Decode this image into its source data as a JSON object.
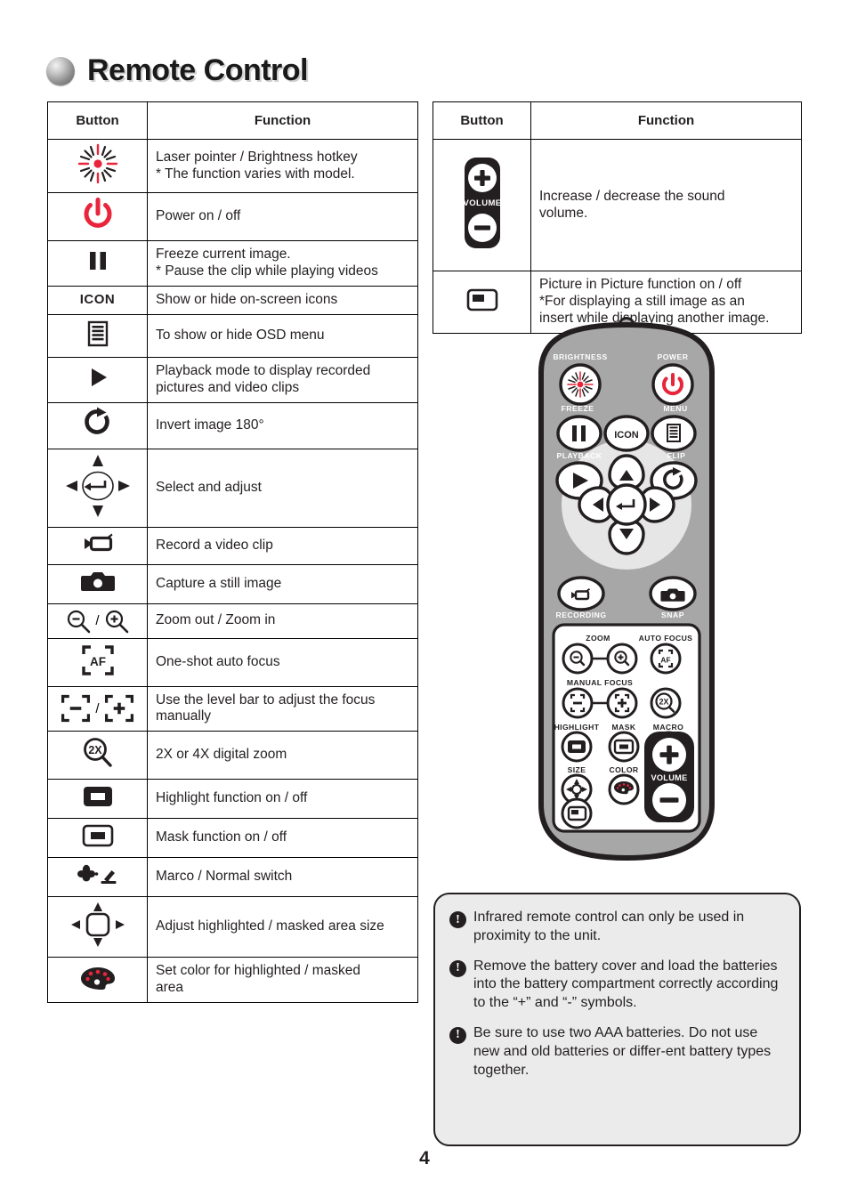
{
  "page": {
    "title": "Remote Control",
    "number": "4",
    "colors": {
      "accent_red": "#E8253A",
      "ink": "#231F20",
      "remote_body": "#A7A7A7",
      "note_bg": "#EBEBEB",
      "dpad_disc": "#E6E6E6"
    }
  },
  "left_table": {
    "headers": {
      "button": "Button",
      "function": "Function"
    },
    "rows": [
      {
        "icon": "laser-burst-icon",
        "function": "Laser pointer / Brightness hotkey\n* The function varies with model."
      },
      {
        "icon": "power-icon",
        "function": "Power on / off"
      },
      {
        "icon": "pause-freeze-icon",
        "function": "Freeze current image.\n* Pause the clip while playing videos"
      },
      {
        "icon": "icon-text-button",
        "icon_label": "ICON",
        "function": "Show or hide on-screen icons"
      },
      {
        "icon": "menu-osd-icon",
        "function": "To show or hide OSD menu"
      },
      {
        "icon": "play-playback-icon",
        "function": "Playback mode to display recorded\npictures and video clips"
      },
      {
        "icon": "flip-rotate-icon",
        "function": "Invert image 180°"
      },
      {
        "icon": "dpad-select-icon",
        "function": "Select and adjust"
      },
      {
        "icon": "video-record-icon",
        "function": "Record a video clip"
      },
      {
        "icon": "camera-snap-icon",
        "function": "Capture a still image"
      },
      {
        "icon": "zoom-out-in-icon",
        "separator": "/",
        "function": "Zoom out / Zoom in"
      },
      {
        "icon": "auto-focus-af-icon",
        "function": "One-shot auto focus"
      },
      {
        "icon": "manual-focus-minus-plus-icon",
        "separator": "/",
        "function": "Use the level bar to adjust the focus\nmanually"
      },
      {
        "icon": "digital-zoom-2x-icon",
        "function": "2X or 4X digital zoom"
      },
      {
        "icon": "highlight-icon",
        "function": "Highlight function on / off"
      },
      {
        "icon": "mask-icon",
        "function": "Mask function on / off"
      },
      {
        "icon": "macro-normal-icon",
        "function": "Marco / Normal switch"
      },
      {
        "icon": "size-adjust-icon",
        "function": "Adjust highlighted / masked area size"
      },
      {
        "icon": "color-palette-icon",
        "function": "Set color for highlighted / masked\narea"
      }
    ]
  },
  "right_table": {
    "headers": {
      "button": "Button",
      "function": "Function"
    },
    "rows": [
      {
        "icon": "volume-rocker-icon",
        "icon_label": "VOLUME",
        "function": "Increase / decrease the sound\nvolume."
      },
      {
        "icon": "pip-icon",
        "function": "Picture in Picture function on / off\n*For displaying a still image as an\ninsert while displaying another image."
      }
    ]
  },
  "remote": {
    "labels": {
      "brightness": "BRIGHTNESS",
      "power": "POWER",
      "freeze": "FREEZE",
      "menu": "MENU",
      "icon": "ICON",
      "playback": "PLAYBACK",
      "flip": "FLIP",
      "recording": "RECORDING",
      "snap": "SNAP",
      "zoom": "ZOOM",
      "auto_focus": "AUTO FOCUS",
      "manual_focus": "MANUAL FOCUS",
      "highlight": "HIGHLIGHT",
      "mask": "MASK",
      "macro": "MACRO",
      "size": "SIZE",
      "color": "COLOR",
      "pip": "PIP",
      "volume": "VOLUME",
      "digital_zoom": "2X"
    }
  },
  "notes": [
    "Infrared remote control can only be used in proximity to the unit.",
    "Remove the battery cover and load the batteries into the battery compartment correctly according to the “+” and “-” symbols.",
    "Be sure to use two AAA batteries. Do not use new and old batteries or differ-ent battery types together."
  ]
}
